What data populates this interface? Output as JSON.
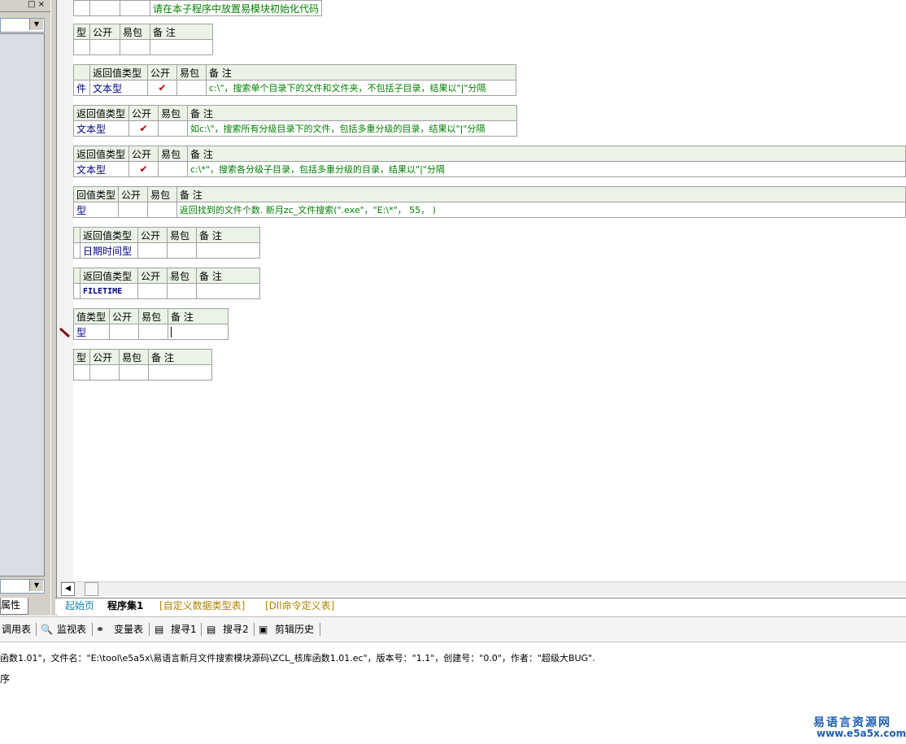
{
  "left_panel": {
    "window_buttons": "□ ×",
    "properties_tab": "属性"
  },
  "tables": [
    {
      "headers": [],
      "row": [
        "请在本子程序中放置易模块初始化代码"
      ]
    },
    {
      "headers": [
        "型",
        "公开",
        "易包",
        "备 注"
      ],
      "row": [
        "",
        "",
        "",
        ""
      ]
    },
    {
      "headers": [
        "",
        "返回值类型",
        "公开",
        "易包",
        "备 注"
      ],
      "row": [
        "件",
        "文本型",
        "✔",
        "",
        "c:\\\"，搜索单个目录下的文件和文件夹，不包括子目录，结果以\"|\"分隔"
      ]
    },
    {
      "headers": [
        "返回值类型",
        "公开",
        "易包",
        "备 注"
      ],
      "row": [
        "文本型",
        "✔",
        "",
        "如c:\\\"，搜索所有分级目录下的文件，包括多重分级的目录，结果以\"|\"分隔"
      ]
    },
    {
      "headers": [
        "返回值类型",
        "公开",
        "易包",
        "备 注"
      ],
      "row": [
        "文本型",
        "✔",
        "",
        "c:\\*\"，搜索各分级子目录，包括多重分级的目录，结果以\"|\"分隔"
      ]
    },
    {
      "headers": [
        "回值类型",
        "公开",
        "易包",
        "备 注"
      ],
      "row": [
        "型",
        "",
        "",
        "返回找到的文件个数. 新月zc_文件搜索(\".exe\"，\"E:\\*\"， 55， )"
      ]
    },
    {
      "headers": [
        "",
        "返回值类型",
        "公开",
        "易包",
        "备 注"
      ],
      "row": [
        "",
        "日期时间型",
        "",
        "",
        ""
      ]
    },
    {
      "headers": [
        "",
        "返回值类型",
        "公开",
        "易包",
        "备 注"
      ],
      "row": [
        "",
        "FILETIME",
        "",
        "",
        ""
      ]
    },
    {
      "headers": [
        "值类型",
        "公开",
        "易包",
        "备 注"
      ],
      "row": [
        "型",
        "",
        "",
        ""
      ]
    },
    {
      "headers": [
        "型",
        "公开",
        "易包",
        "备 注"
      ],
      "row": [
        "",
        "",
        "",
        ""
      ]
    }
  ],
  "tabs": [
    "起始页",
    "程序集1",
    "[自定义数据类型表]",
    "[Dll命令定义表]"
  ],
  "toolbar": [
    "调用表",
    "监视表",
    "变量表",
    "搜寻1",
    "搜寻2",
    "剪辑历史"
  ],
  "output": {
    "line1": "函数1.01\"，文件名：\"E:\\tool\\e5a5x\\易语言新月文件搜索模块源码\\ZCL_核库函数1.01.ec\"，版本号：\"1.1\"，创建号：\"0.0\"，作者：\"超级大BUG\".",
    "line2": "序"
  },
  "watermark": {
    "title": "易语言资源网",
    "url": "www.e5a5x.com"
  },
  "colors": {
    "header_bg": "#eaf3e6",
    "comment": "#008000",
    "type": "#000080",
    "check": "#b00000"
  }
}
